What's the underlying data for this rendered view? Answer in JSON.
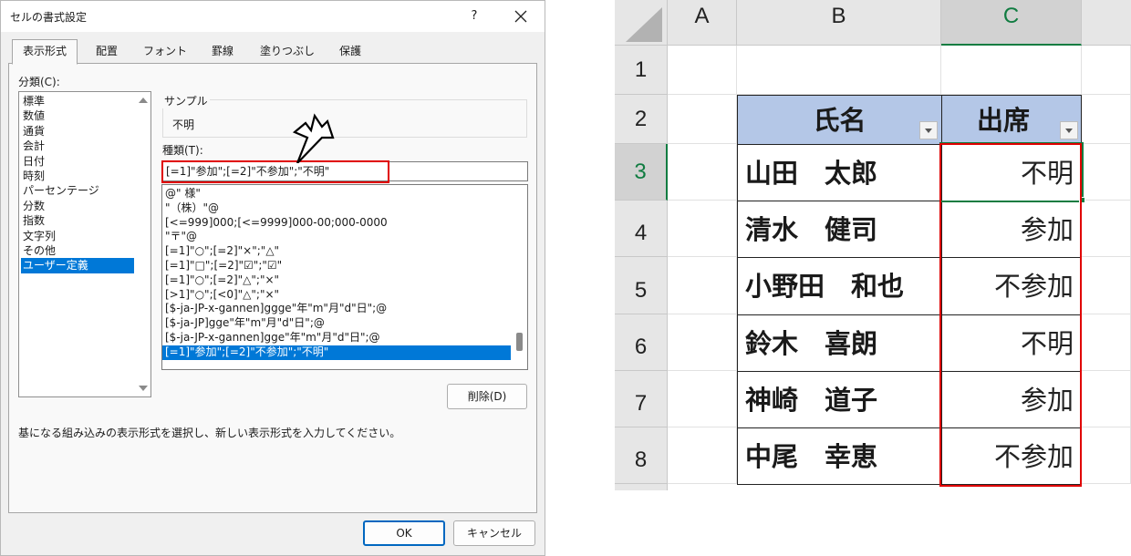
{
  "dialog": {
    "title": "セルの書式設定",
    "help_label": "?",
    "tabs": [
      "表示形式",
      "配置",
      "フォント",
      "罫線",
      "塗りつぶし",
      "保護"
    ],
    "active_tab": "表示形式",
    "category_label": "分類(C):",
    "categories": [
      "標準",
      "数値",
      "通貨",
      "会計",
      "日付",
      "時刻",
      "パーセンテージ",
      "分数",
      "指数",
      "文字列",
      "その他",
      "ユーザー定義"
    ],
    "selected_category": "ユーザー定義",
    "sample_label": "サンプル",
    "sample_value": "不明",
    "type_label": "種類(T):",
    "type_value": "[=1]\"参加\";[=2]\"不参加\";\"不明\"",
    "format_list": [
      "@\" 様\"",
      "\"（株）\"@",
      "[<=999]000;[<=9999]000-00;000-0000",
      "\"〒\"@",
      "[=1]\"○\";[=2]\"×\";\"△\"",
      "[=1]\"□\";[=2]\"☑\";\"☑\"",
      "[=1]\"○\";[=2]\"△\";\"×\"",
      "[>1]\"○\";[<0]\"△\";\"×\"",
      "[$-ja-JP-x-gannen]ggge\"年\"m\"月\"d\"日\";@",
      "[$-ja-JP]gge\"年\"m\"月\"d\"日\";@",
      "[$-ja-JP-x-gannen]gge\"年\"m\"月\"d\"日\";@",
      "[=1]\"参加\";[=2]\"不参加\";\"不明\""
    ],
    "delete_button": "削除(D)",
    "hint": "基になる組み込みの表示形式を選択し、新しい表示形式を入力してください。",
    "ok_button": "OK",
    "cancel_button": "キャンセル",
    "highlight_color": "#e00000",
    "selection_color": "#0078d7"
  },
  "sheet": {
    "columns": [
      "A",
      "B",
      "C"
    ],
    "rows": [
      "1",
      "2",
      "3",
      "4",
      "5",
      "6",
      "7",
      "8"
    ],
    "active_cell": "C3",
    "table": {
      "headers": [
        "氏名",
        "出席"
      ],
      "rows": [
        {
          "name": "山田　太郎",
          "attendance": "不明"
        },
        {
          "name": "清水　健司",
          "attendance": "参加"
        },
        {
          "name": "小野田　和也",
          "attendance": "不参加"
        },
        {
          "name": "鈴木　喜朗",
          "attendance": "不明"
        },
        {
          "name": "神崎　道子",
          "attendance": "参加"
        },
        {
          "name": "中尾　幸恵",
          "attendance": "不参加"
        }
      ]
    },
    "header_fill": "#b4c7e7",
    "accent_color": "#107c41",
    "highlight_color": "#e00000"
  }
}
